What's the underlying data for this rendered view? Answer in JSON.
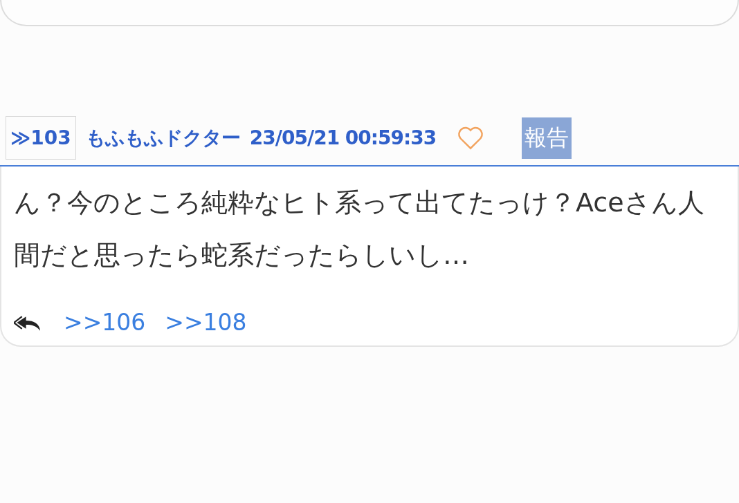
{
  "post": {
    "number": "≫103",
    "author": "もふもふドクター",
    "datetime": "23/05/21 00:59:33",
    "liked": false,
    "report_label": "報告",
    "body": "ん？今のところ純粋なヒト系って出てたっけ？Aceさん人間だと思ったら蛇系だったらしいし…",
    "replies": [
      ">>106",
      ">>108"
    ]
  }
}
